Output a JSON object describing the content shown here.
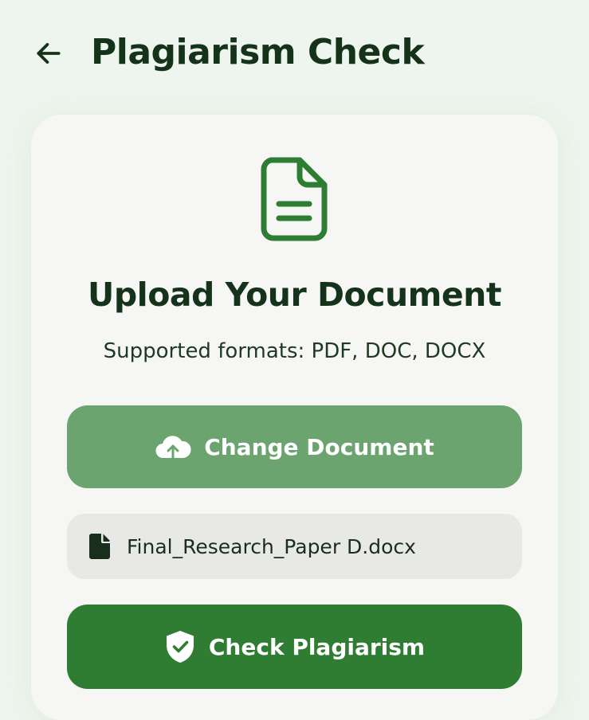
{
  "header": {
    "back_icon": "arrow-left-icon",
    "title": "Plagiarism Check"
  },
  "upload_card": {
    "document_icon": "document-icon",
    "title": "Upload Your Document",
    "subtitle": "Supported formats: PDF, DOC, DOCX",
    "change_button": {
      "icon": "cloud-upload-icon",
      "label": "Change Document"
    },
    "selected_file": {
      "icon": "file-icon",
      "name": "Final_Research_Paper D.docx"
    },
    "check_button": {
      "icon": "shield-check-icon",
      "label": "Check Plagiarism"
    }
  },
  "colors": {
    "background": "#eef5ee",
    "card": "#f6f6f5",
    "title_text": "#15331a",
    "accent_green": "#2e7d32",
    "light_green": "#6ba46f",
    "file_row": "#e8e8e7"
  }
}
